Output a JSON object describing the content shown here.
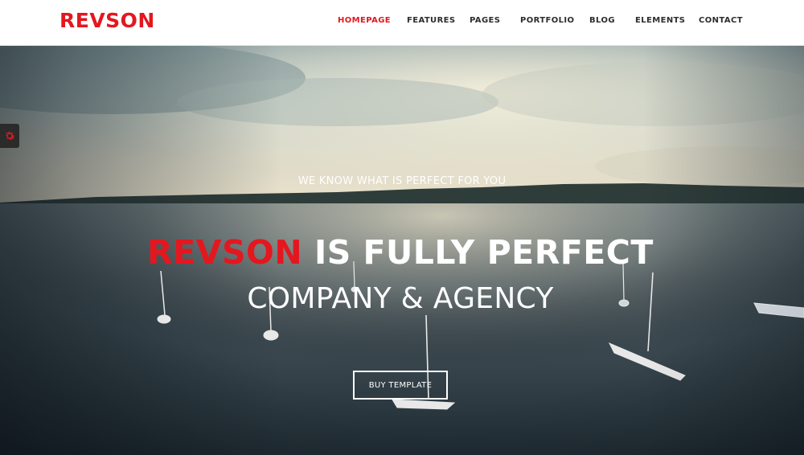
{
  "header": {
    "logo": "REVSON",
    "nav": [
      {
        "label": "HOMEPAGE",
        "active": true
      },
      {
        "label": "FEATURES",
        "active": false
      },
      {
        "label": "PAGES",
        "active": false
      },
      {
        "label": "PORTFOLIO",
        "active": false
      },
      {
        "label": "BLOG",
        "active": false
      },
      {
        "label": "ELEMENTS",
        "active": false
      },
      {
        "label": "CONTACT",
        "active": false
      }
    ]
  },
  "hero": {
    "tagline": "WE KNOW WHAT IS PERFECT FOR YOU",
    "headline_brand": "REVSON",
    "headline_rest": " IS FULLY PERFECT",
    "subheadline": "COMPANY & AGENCY",
    "cta_label": "BUY TEMPLATE",
    "background": "aerial-lake-with-sailboats-photo"
  },
  "settings": {
    "icon": "gear-icon"
  },
  "colors": {
    "accent": "#e4171f",
    "nav_text": "#2d2d2d",
    "settings_tab": "#2b2b2b"
  }
}
